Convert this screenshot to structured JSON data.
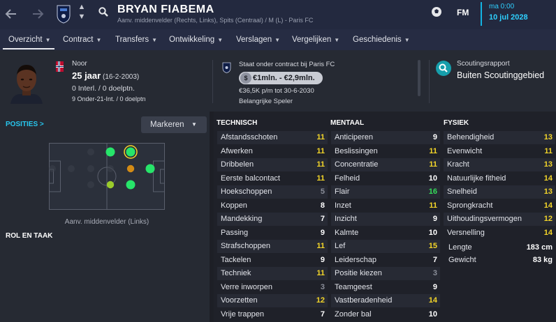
{
  "header": {
    "player_name": "BRYAN FIABEMA",
    "subtitle": "Aanv. middenvelder (Rechts, Links), Spits (Centraal) / M (L) - Paris FC",
    "logo": "FM",
    "time": "ma 0:00",
    "date": "10 jul 2028",
    "icons": [
      "back-arrow-icon",
      "forward-arrow-icon",
      "club-crest-icon",
      "up-down-icon",
      "search-icon",
      "ball-icon"
    ]
  },
  "nav": {
    "items": [
      {
        "label": "Overzicht"
      },
      {
        "label": "Contract"
      },
      {
        "label": "Transfers"
      },
      {
        "label": "Ontwikkeling"
      },
      {
        "label": "Verslagen"
      },
      {
        "label": "Vergelijken"
      },
      {
        "label": "Geschiedenis"
      }
    ],
    "active": "Overzicht"
  },
  "info": {
    "nationality": "Noor",
    "age": "25 jaar",
    "dob": "(16-2-2003)",
    "caps": "0 Interl. / 0 doelptn.",
    "u21": "9 Onder-21-Int. / 0 doelptn",
    "contract_title": "Staat onder contract bij Paris FC",
    "value_symbol": "$",
    "value": "€1mln. - €2,9mln.",
    "wage": "€36,5K p/m tot 30-6-2030",
    "status": "Belangrijke Speler",
    "scout_title": "Scoutingsrapport",
    "scout_value": "Buiten Scoutinggebied"
  },
  "positions": {
    "title": "POSITIES",
    "title_arrow": ">",
    "button": "Markeren",
    "role_label": "Aanv. middenvelder (Links)",
    "rol_title": "ROL EN TAAK",
    "colors": {
      "natural": "#27e56a",
      "accomplished": "#9acb2b",
      "unconvincing": "#d38b15",
      "empty": "#3c414d"
    }
  },
  "attributes": {
    "technical": {
      "title": "TECHNISCH",
      "rows": [
        {
          "name": "Afstandsschoten",
          "value": "11"
        },
        {
          "name": "Afwerken",
          "value": "11"
        },
        {
          "name": "Dribbelen",
          "value": "11"
        },
        {
          "name": "Eerste balcontact",
          "value": "11"
        },
        {
          "name": "Hoekschoppen",
          "value": "5"
        },
        {
          "name": "Koppen",
          "value": "8"
        },
        {
          "name": "Mandekking",
          "value": "7"
        },
        {
          "name": "Passing",
          "value": "9"
        },
        {
          "name": "Strafschoppen",
          "value": "11"
        },
        {
          "name": "Tackelen",
          "value": "9"
        },
        {
          "name": "Techniek",
          "value": "11"
        },
        {
          "name": "Verre inworpen",
          "value": "3"
        },
        {
          "name": "Voorzetten",
          "value": "12"
        },
        {
          "name": "Vrije trappen",
          "value": "7"
        }
      ]
    },
    "mental": {
      "title": "MENTAAL",
      "rows": [
        {
          "name": "Anticiperen",
          "value": "9"
        },
        {
          "name": "Beslissingen",
          "value": "11"
        },
        {
          "name": "Concentratie",
          "value": "11"
        },
        {
          "name": "Felheid",
          "value": "10"
        },
        {
          "name": "Flair",
          "value": "16"
        },
        {
          "name": "Inzet",
          "value": "11"
        },
        {
          "name": "Inzicht",
          "value": "9"
        },
        {
          "name": "Kalmte",
          "value": "10"
        },
        {
          "name": "Lef",
          "value": "15"
        },
        {
          "name": "Leiderschap",
          "value": "7"
        },
        {
          "name": "Positie kiezen",
          "value": "3"
        },
        {
          "name": "Teamgeest",
          "value": "9"
        },
        {
          "name": "Vastberadenheid",
          "value": "14"
        },
        {
          "name": "Zonder bal",
          "value": "10"
        }
      ]
    },
    "physical": {
      "title": "FYSIEK",
      "rows": [
        {
          "name": "Behendigheid",
          "value": "13"
        },
        {
          "name": "Evenwicht",
          "value": "11"
        },
        {
          "name": "Kracht",
          "value": "13"
        },
        {
          "name": "Natuurlijke fitheid",
          "value": "14"
        },
        {
          "name": "Snelheid",
          "value": "13"
        },
        {
          "name": "Sprongkracht",
          "value": "14"
        },
        {
          "name": "Uithoudingsvermogen",
          "value": "12"
        },
        {
          "name": "Versnelling",
          "value": "14"
        }
      ],
      "extra": [
        {
          "name": "Lengte",
          "value": "183 cm"
        },
        {
          "name": "Gewicht",
          "value": "83 kg"
        }
      ]
    },
    "value_colors": {
      "low": "#8a8e99",
      "mid": "#ffffff",
      "good": "#f4d629",
      "great": "#35dc5a"
    }
  }
}
